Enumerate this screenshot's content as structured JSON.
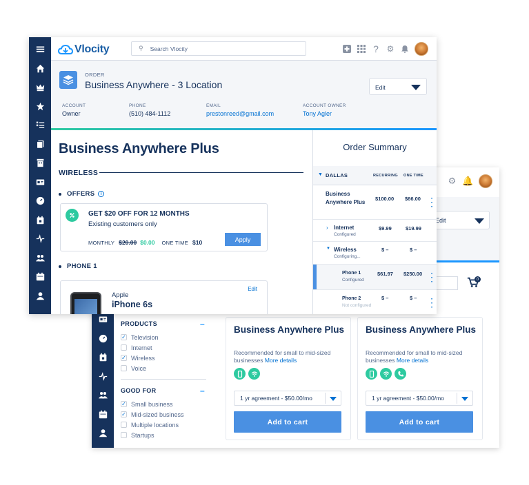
{
  "colors": {
    "nav": "#16325c",
    "accent": "#4a90e2",
    "brand": "#1b5fa6",
    "teal": "#2ecaa0"
  },
  "front": {
    "logo_text": "Vlocity",
    "search_placeholder": "Search Vlocity",
    "topbar_icons": [
      "plus-icon",
      "apps-grid-icon",
      "help-icon",
      "gear-icon",
      "bell-icon",
      "avatar"
    ],
    "nav_icons": [
      "menu-icon",
      "home-icon",
      "crown-icon",
      "star-icon",
      "list-icon",
      "documents-icon",
      "building-icon",
      "contact-card-icon",
      "gauge-icon",
      "calendar-box-icon",
      "pulse-icon",
      "people-icon",
      "calendar-icon",
      "user-icon"
    ],
    "record": {
      "type": "ORDER",
      "title": "Business Anywhere - 3 Location",
      "edit_label": "Edit",
      "fields": [
        {
          "label": "ACCOUNT",
          "value": "Owner"
        },
        {
          "label": "PHONE",
          "value": "(510) 484-1112"
        },
        {
          "label": "EMAIL",
          "value": "prestonreed@gmail.com"
        },
        {
          "label": "ACCOUNT OWNER",
          "value": "Tony Agler"
        }
      ]
    },
    "main": {
      "heading": "Business Anywhere Plus",
      "section": "WIRELESS",
      "offers_title": "OFFERS",
      "offer": {
        "title": "GET $20 OFF FOR 12 MONTHS",
        "subtitle": "Existing customers only",
        "monthly_label": "MONTHLY",
        "old_price": "$20.00",
        "new_price": "$0.00",
        "one_time_label": "ONE TIME",
        "one_time_price": "$10",
        "apply_label": "Apply"
      },
      "phone_title": "PHONE 1",
      "phone": {
        "brand": "Apple",
        "model": "iPhone 6s",
        "edit_label": "Edit"
      }
    },
    "order_summary": {
      "title": "Order Summary",
      "location": "DALLAS",
      "col_recurring": "RECURRING",
      "col_one_time": "ONE TIME",
      "rows": [
        {
          "name": "Business Anywhere Plus",
          "status": "",
          "recurring": "$100.00",
          "one_time": "$66.00"
        },
        {
          "name": "Internet",
          "status": "Configured",
          "recurring": "$9.99",
          "one_time": "$19.99"
        },
        {
          "name": "Wireless",
          "status": "Configuring...",
          "recurring": "$ –",
          "one_time": "$ –"
        },
        {
          "name": "Phone 1",
          "status": "Configured",
          "recurring": "$61.97",
          "one_time": "$250.00"
        },
        {
          "name": "Phone 2",
          "status": "Not configured",
          "recurring": "$ –",
          "one_time": "$ –"
        }
      ]
    }
  },
  "back": {
    "edit_label": "Edit",
    "cart_count": "0",
    "filters": [
      {
        "title": "PRODUCTS",
        "items": [
          {
            "label": "Television",
            "checked": true
          },
          {
            "label": "Internet",
            "checked": false
          },
          {
            "label": "Wireless",
            "checked": true
          },
          {
            "label": "Voice",
            "checked": false
          }
        ]
      },
      {
        "title": "GOOD FOR",
        "items": [
          {
            "label": "Small business",
            "checked": true
          },
          {
            "label": "Mid-sized business",
            "checked": true
          },
          {
            "label": "Multiple locations",
            "checked": false
          },
          {
            "label": "Startups",
            "checked": false
          }
        ]
      }
    ],
    "products": [
      {
        "title": "Business Anywhere Plus",
        "desc": "Recommended for small to mid-sized businesses",
        "more": "More details",
        "icons": [
          "mobile-phone-icon",
          "wifi-icon"
        ],
        "plan": "1 yr agreement - $50.00/mo",
        "cta": "Add to cart"
      },
      {
        "title": "Business Anywhere Plus",
        "desc": "Recommended for small to mid-sized businesses",
        "more": "More details",
        "icons": [
          "mobile-phone-icon",
          "wifi-icon",
          "phone-handset-icon"
        ],
        "plan": "1 yr agreement - $50.00/mo",
        "cta": "Add to cart"
      }
    ]
  }
}
